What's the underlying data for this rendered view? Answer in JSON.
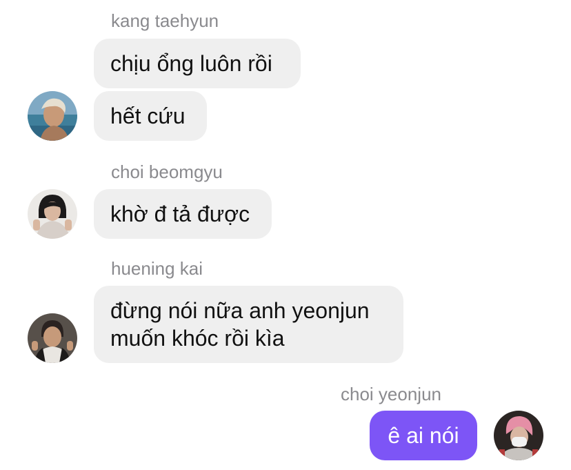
{
  "messages": [
    {
      "sender": "kang taehyun",
      "lines": [
        "chịu ổng luôn rồi",
        "hết cứu"
      ],
      "avatar_icon": "user-avatar-photo"
    },
    {
      "sender": "choi beomgyu",
      "lines": [
        "khờ đ tả được"
      ],
      "avatar_icon": "user-avatar-photo"
    },
    {
      "sender": "huening kai",
      "lines": [
        "đừng nói nữa anh yeonjun",
        "muốn khóc rồi kìa"
      ],
      "avatar_icon": "user-avatar-photo"
    },
    {
      "sender": "choi yeonjun",
      "lines": [
        "ê ai nói"
      ],
      "avatar_icon": "user-avatar-photo",
      "outgoing": true
    }
  ],
  "colors": {
    "incoming_bubble": "#efefef",
    "outgoing_bubble": "#7d55f6",
    "sender_name": "#8a8a8e"
  }
}
